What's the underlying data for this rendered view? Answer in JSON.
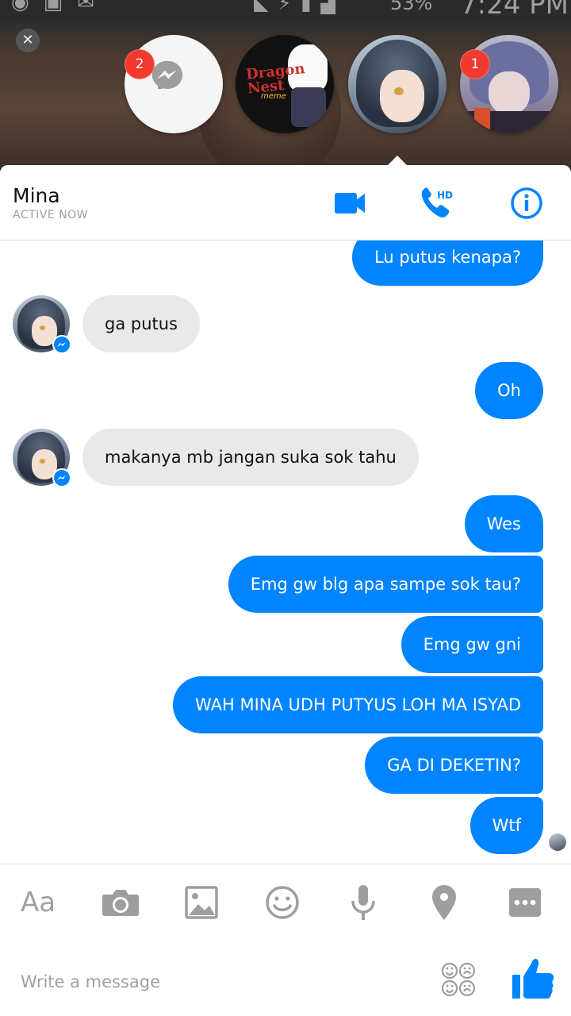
{
  "status_bar": {
    "battery_percent": "53%",
    "time": "7:24 PM"
  },
  "chat_heads": {
    "items": [
      {
        "name": "messenger-chathead",
        "badge": "2"
      },
      {
        "name": "dragon-nest-chathead",
        "title": "Dragon Nest",
        "subtitle": "meme"
      },
      {
        "name": "mina-chathead"
      },
      {
        "name": "contact-chathead",
        "badge": "1"
      }
    ]
  },
  "conversation": {
    "contact_name": "Mina",
    "presence": "ACTIVE NOW",
    "call_badge": "HD"
  },
  "messages": [
    {
      "from": "me",
      "text": "Lu putus kenapa?"
    },
    {
      "from": "them",
      "text": "ga putus"
    },
    {
      "from": "me",
      "text": "Oh"
    },
    {
      "from": "them",
      "text": "makanya mb jangan suka sok tahu"
    },
    {
      "from": "me",
      "text": "Wes"
    },
    {
      "from": "me",
      "text": "Emg gw blg apa sampe sok tau?"
    },
    {
      "from": "me",
      "text": "Emg gw gni"
    },
    {
      "from": "me",
      "text": "WAH MINA UDH PUTYUS LOH MA ISYAD"
    },
    {
      "from": "me",
      "text": "GA DI DEKETIN?"
    },
    {
      "from": "me",
      "text": "Wtf"
    }
  ],
  "toolbar": {
    "text_label": "Aa",
    "icons": [
      "camera-icon",
      "gallery-icon",
      "emoji-icon",
      "microphone-icon",
      "location-icon",
      "more-icon"
    ]
  },
  "composer": {
    "placeholder": "Write a message",
    "value": ""
  },
  "colors": {
    "accent": "#0084ff",
    "incoming_bubble": "#e9e9e9",
    "badge": "#f33a2f"
  }
}
